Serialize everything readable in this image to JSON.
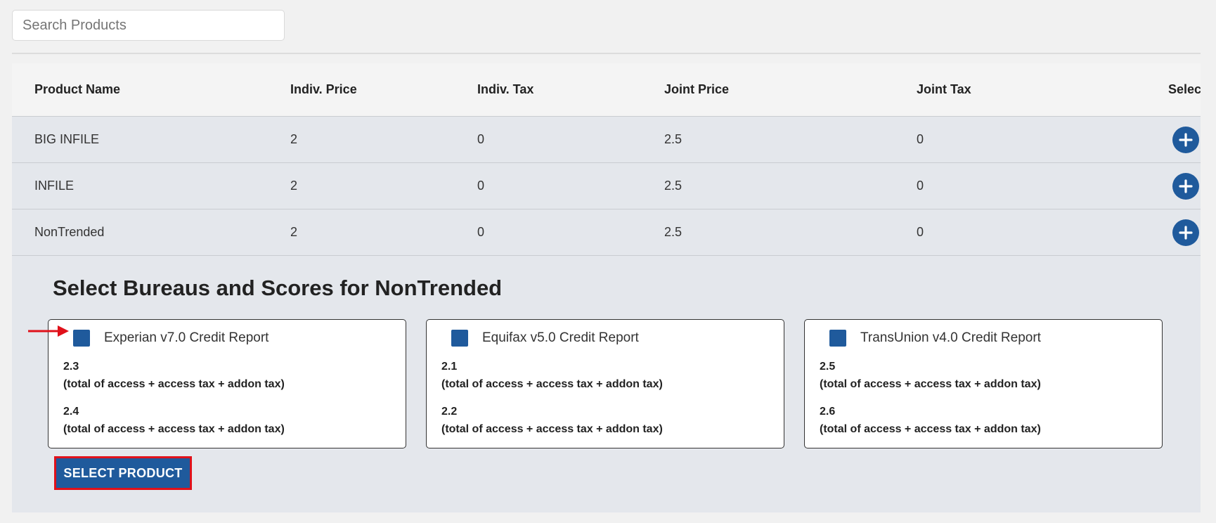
{
  "search": {
    "placeholder": "Search Products",
    "value": ""
  },
  "table": {
    "headers": [
      "Product Name",
      "Indiv. Price",
      "Indiv. Tax",
      "Joint Price",
      "Joint Tax",
      "Select"
    ],
    "rows": [
      {
        "name": "BIG INFILE",
        "indiv_price": "2",
        "indiv_tax": "0",
        "joint_price": "2.5",
        "joint_tax": "0"
      },
      {
        "name": "INFILE",
        "indiv_price": "2",
        "indiv_tax": "0",
        "joint_price": "2.5",
        "joint_tax": "0"
      },
      {
        "name": "NonTrended",
        "indiv_price": "2",
        "indiv_tax": "0",
        "joint_price": "2.5",
        "joint_tax": "0"
      }
    ]
  },
  "panel": {
    "title": "Select Bureaus and Scores for NonTrended",
    "bureaus": [
      {
        "label": "Experian v7.0 Credit Report",
        "score_a_value": "2.3",
        "score_a_note": "(total of access + access tax + addon tax)",
        "score_b_value": "2.4",
        "score_b_note": "(total of access + access tax + addon tax)"
      },
      {
        "label": "Equifax v5.0 Credit Report",
        "score_a_value": "2.1",
        "score_a_note": "(total of access + access tax + addon tax)",
        "score_b_value": "2.2",
        "score_b_note": "(total of access + access tax + addon tax)"
      },
      {
        "label": "TransUnion v4.0 Credit Report",
        "score_a_value": "2.5",
        "score_a_note": "(total of access + access tax + addon tax)",
        "score_b_value": "2.6",
        "score_b_note": "(total of access + access tax + addon tax)"
      }
    ],
    "select_button_label": "SELECT PRODUCT"
  },
  "icons": {
    "add": "plus-circle-icon",
    "annotation": "red-arrow-icon"
  },
  "colors": {
    "primary": "#1f5a9c",
    "highlight": "#e0111a",
    "row_bg": "#e4e7ec",
    "header_bg": "#f4f4f4"
  }
}
